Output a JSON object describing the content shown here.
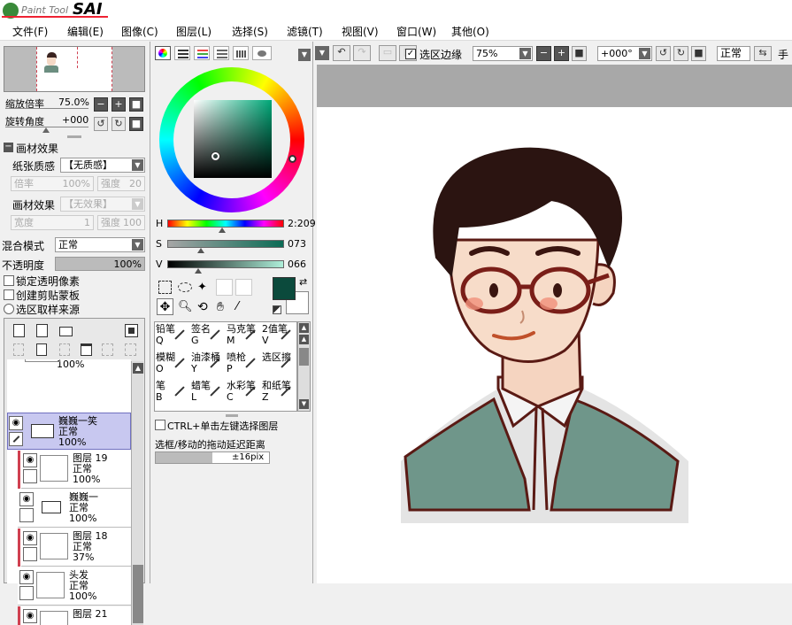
{
  "app": {
    "logo_small": "Paint Tool",
    "logo_big": "SAI"
  },
  "menu": [
    "文件(F)",
    "编辑(E)",
    "图像(C)",
    "图层(L)",
    "选择(S)",
    "滤镜(T)",
    "视图(V)",
    "窗口(W)",
    "其他(O)"
  ],
  "navigator": {
    "zoom_label": "缩放倍率",
    "zoom_value": "75.0%",
    "rotate_label": "旋转角度",
    "rotate_value": "+000"
  },
  "brush_texture": {
    "header": "画材效果",
    "paper_label": "纸张质感",
    "paper_value": "【无质感】",
    "rate_label": "倍率",
    "rate_value": "100%",
    "strength_label": "强度",
    "strength_value": "20",
    "effect_label": "画材效果",
    "effect_value": "【无效果】",
    "width_label": "宽度",
    "width_value": "1",
    "strength2_label": "强度",
    "strength2_value": "100"
  },
  "layer_props": {
    "blend_label": "混合模式",
    "blend_value": "正常",
    "opacity_label": "不透明度",
    "opacity_value": "100%",
    "lock_alpha": "锁定透明像素",
    "clip_mask": "创建剪贴蒙板",
    "selection_source": "选区取样来源"
  },
  "layers": [
    {
      "name": "巍巍一笑",
      "mode": "正常",
      "opacity": "100%",
      "kind": "folder",
      "selected": true
    },
    {
      "name": "图层 19",
      "mode": "正常",
      "opacity": "100%",
      "kind": "layer",
      "clip": true
    },
    {
      "name": "巍巍一",
      "mode": "正常",
      "opacity": "100%",
      "kind": "folder"
    },
    {
      "name": "图层 18",
      "mode": "正常",
      "opacity": "37%",
      "kind": "layer",
      "clip": true
    },
    {
      "name": "头发",
      "mode": "正常",
      "opacity": "100%",
      "kind": "layer"
    },
    {
      "name": "图层 21",
      "mode": "",
      "opacity": "",
      "kind": "layer",
      "clip": true
    }
  ],
  "layer_top_partial": "100%",
  "color": {
    "h_label": "H",
    "h_value": "2:209",
    "s_label": "S",
    "s_value": "073",
    "v_label": "V",
    "v_value": "066",
    "fg_color": "#0b4a3c",
    "bg_color": "#ffffff"
  },
  "tools": [
    {
      "name": "铅笔",
      "key": "Q"
    },
    {
      "name": "签名",
      "key": "G"
    },
    {
      "name": "马克笔",
      "key": "M"
    },
    {
      "name": "2值笔",
      "key": "V"
    },
    {
      "name": "模糊",
      "key": "O"
    },
    {
      "name": "油漆桶",
      "key": "Y"
    },
    {
      "name": "喷枪",
      "key": "P"
    },
    {
      "name": "选区擦",
      "key": ""
    },
    {
      "name": "笔",
      "key": "B"
    },
    {
      "name": "蜡笔",
      "key": "L"
    },
    {
      "name": "水彩笔",
      "key": "C"
    },
    {
      "name": "和纸笔",
      "key": "Z"
    }
  ],
  "options": {
    "ctrl_select": "CTRL+单击左键选择图层",
    "drag_delay_label": "选框/移动的拖动延迟距离",
    "drag_delay_value": "±16pix"
  },
  "toolbar": {
    "show_selection": "选区边缘",
    "zoom": "75%",
    "angle": "+000°",
    "mode": "正常",
    "hand": "手"
  },
  "colors": {
    "accent_red": "#d04050",
    "selected_layer": "#c8c8f0"
  }
}
